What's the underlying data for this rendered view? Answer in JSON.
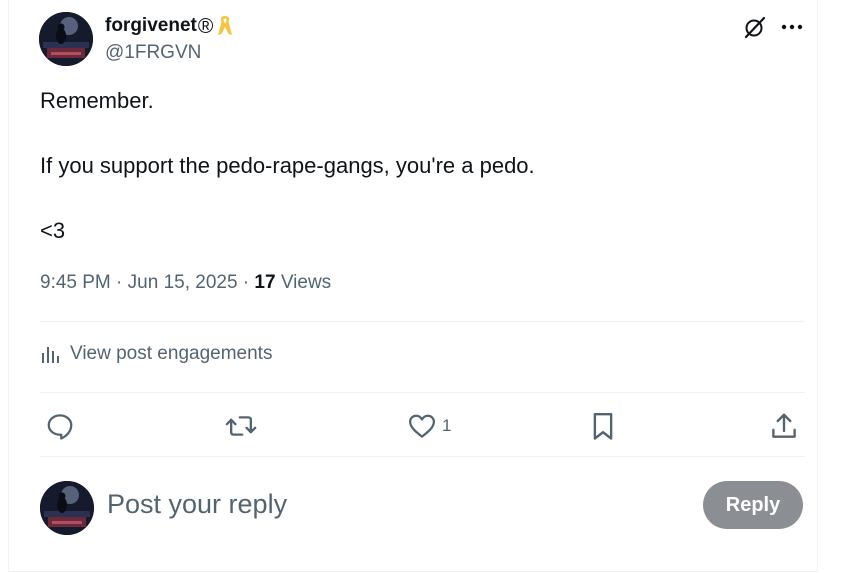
{
  "post": {
    "author": {
      "display_name": "forgivenet",
      "registered_mark": "®",
      "badge_icon": "yellow-ribbon-icon",
      "handle": "@1FRGVN",
      "avatar_icon": "avatar-pianist-image"
    },
    "header_actions": {
      "grok_icon": "grok-icon",
      "more_icon": "more-dots-icon"
    },
    "text_lines": [
      "Remember.",
      "If you support the pedo-rape-gangs, you're a pedo.",
      "<3"
    ],
    "meta": {
      "time": "9:45 PM",
      "sep1": " · ",
      "date": "Jun 15, 2025",
      "sep2": " · ",
      "views_count": "17",
      "views_label": " Views"
    },
    "engagements_label": "View post engagements",
    "actions": {
      "reply_icon": "reply-bubble-icon",
      "repost_icon": "repost-icon",
      "like_icon": "heart-icon",
      "like_count": "1",
      "bookmark_icon": "bookmark-icon",
      "share_icon": "share-icon"
    }
  },
  "reply_box": {
    "placeholder": "Post your reply",
    "button_label": "Reply",
    "button_color": "#8b8f93"
  },
  "colors": {
    "text_primary": "#0f1419",
    "text_secondary": "#536471",
    "divider": "#eff3f4",
    "ribbon": "#f5c542"
  }
}
